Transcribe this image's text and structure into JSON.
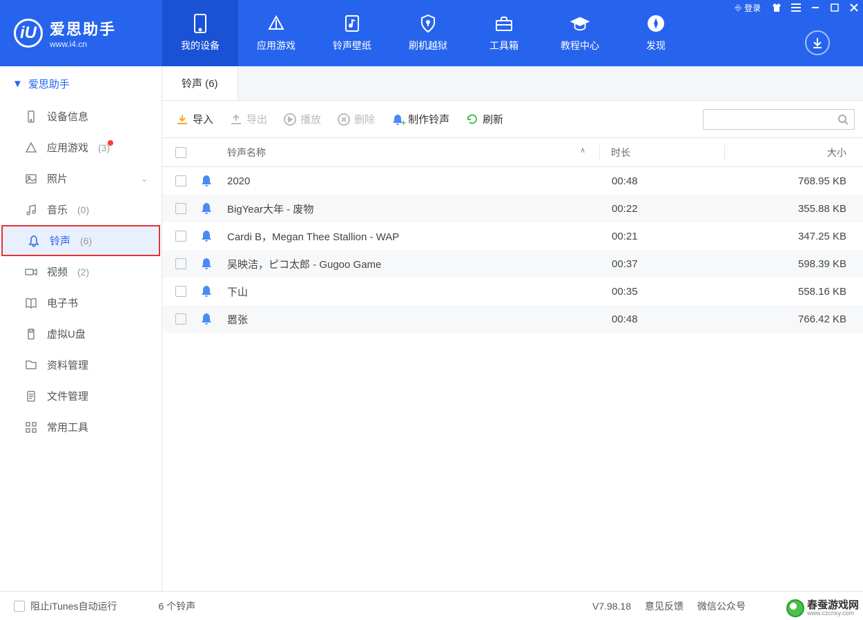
{
  "logo": {
    "title": "爱思助手",
    "url": "www.i4.cn",
    "mark": "iU"
  },
  "titlebar": {
    "login": "登录"
  },
  "nav": [
    {
      "label": "我的设备",
      "active": true
    },
    {
      "label": "应用游戏"
    },
    {
      "label": "铃声壁纸"
    },
    {
      "label": "刷机越狱"
    },
    {
      "label": "工具箱"
    },
    {
      "label": "教程中心"
    },
    {
      "label": "发现"
    }
  ],
  "sidebar": {
    "header": "爱思助手",
    "items": [
      {
        "id": "device-info",
        "label": "设备信息"
      },
      {
        "id": "apps",
        "label": "应用游戏",
        "count": "(3)",
        "badge": true
      },
      {
        "id": "photos",
        "label": "照片",
        "chevron": true
      },
      {
        "id": "music",
        "label": "音乐",
        "count": "(0)"
      },
      {
        "id": "ringtones",
        "label": "铃声",
        "count": "(6)",
        "selected": true
      },
      {
        "id": "videos",
        "label": "视频",
        "count": "(2)"
      },
      {
        "id": "ebooks",
        "label": "电子书"
      },
      {
        "id": "vdisk",
        "label": "虚拟U盘"
      },
      {
        "id": "data",
        "label": "资料管理"
      },
      {
        "id": "files",
        "label": "文件管理"
      },
      {
        "id": "tools",
        "label": "常用工具"
      }
    ]
  },
  "content": {
    "tab_label": "铃声 (6)",
    "toolbar": {
      "import": "导入",
      "export": "导出",
      "play": "播放",
      "delete": "删除",
      "make": "制作铃声",
      "refresh": "刷新"
    },
    "columns": {
      "name": "铃声名称",
      "duration": "时长",
      "size": "大小"
    },
    "rows": [
      {
        "name": "2020",
        "duration": "00:48",
        "size": "768.95 KB"
      },
      {
        "name": "BigYear大年 - 废物",
        "duration": "00:22",
        "size": "355.88 KB"
      },
      {
        "name": "Cardi B，Megan Thee Stallion - WAP",
        "duration": "00:21",
        "size": "347.25 KB"
      },
      {
        "name": "吴映洁，ピコ太郎 - Gugoo Game",
        "duration": "00:37",
        "size": "598.39 KB"
      },
      {
        "name": "下山",
        "duration": "00:35",
        "size": "558.16 KB"
      },
      {
        "name": "嚣张",
        "duration": "00:48",
        "size": "766.42 KB"
      }
    ]
  },
  "status": {
    "block_itunes": "阻止iTunes自动运行",
    "count": "6 个铃声",
    "version": "V7.98.18",
    "feedback": "意见反馈",
    "wechat": "微信公众号"
  },
  "watermark": {
    "main": "春蚕游戏网",
    "sub": "www.czcnxy.com"
  }
}
